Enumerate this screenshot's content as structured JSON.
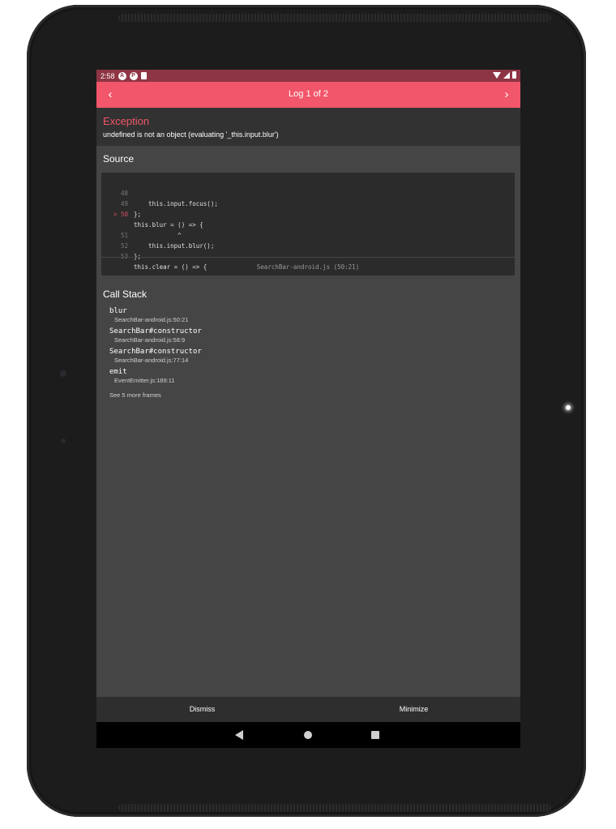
{
  "status_bar": {
    "time": "2:58",
    "icons": [
      "a-icon",
      "p-icon",
      "sd-card-icon"
    ]
  },
  "header": {
    "title": "Log 1 of 2",
    "prev_glyph": "‹",
    "next_glyph": "›"
  },
  "exception": {
    "title": "Exception",
    "message": "undefined is not an object (evaluating '_this.input.blur')"
  },
  "source": {
    "title": "Source",
    "lines": [
      {
        "num": "48",
        "code": "    this.input.focus();"
      },
      {
        "num": "49",
        "code": "};"
      },
      {
        "num": "> 50",
        "code": "this.blur = () => {"
      },
      {
        "num": "",
        "code": "            ^"
      },
      {
        "num": "51",
        "code": "    this.input.blur();"
      },
      {
        "num": "52",
        "code": "};"
      },
      {
        "num": "53",
        "code": "this.clear = () => {"
      }
    ],
    "file": "SearchBar-android.js (50:21)"
  },
  "call_stack": {
    "title": "Call Stack",
    "frames": [
      {
        "fn": "blur",
        "loc": "SearchBar-android.js:50:21"
      },
      {
        "fn": "SearchBar#constructor",
        "loc": "SearchBar-android.js:58:9"
      },
      {
        "fn": "SearchBar#constructor",
        "loc": "SearchBar-android.js:77:14"
      },
      {
        "fn": "emit",
        "loc": "EventEmitter.js:189:11"
      }
    ],
    "see_more": "See 5 more frames"
  },
  "footer": {
    "dismiss": "Dismiss",
    "minimize": "Minimize"
  },
  "colors": {
    "accent": "#f2566a",
    "status_bar": "#8e3545",
    "panel": "#454545",
    "dark_panel": "#323232"
  }
}
